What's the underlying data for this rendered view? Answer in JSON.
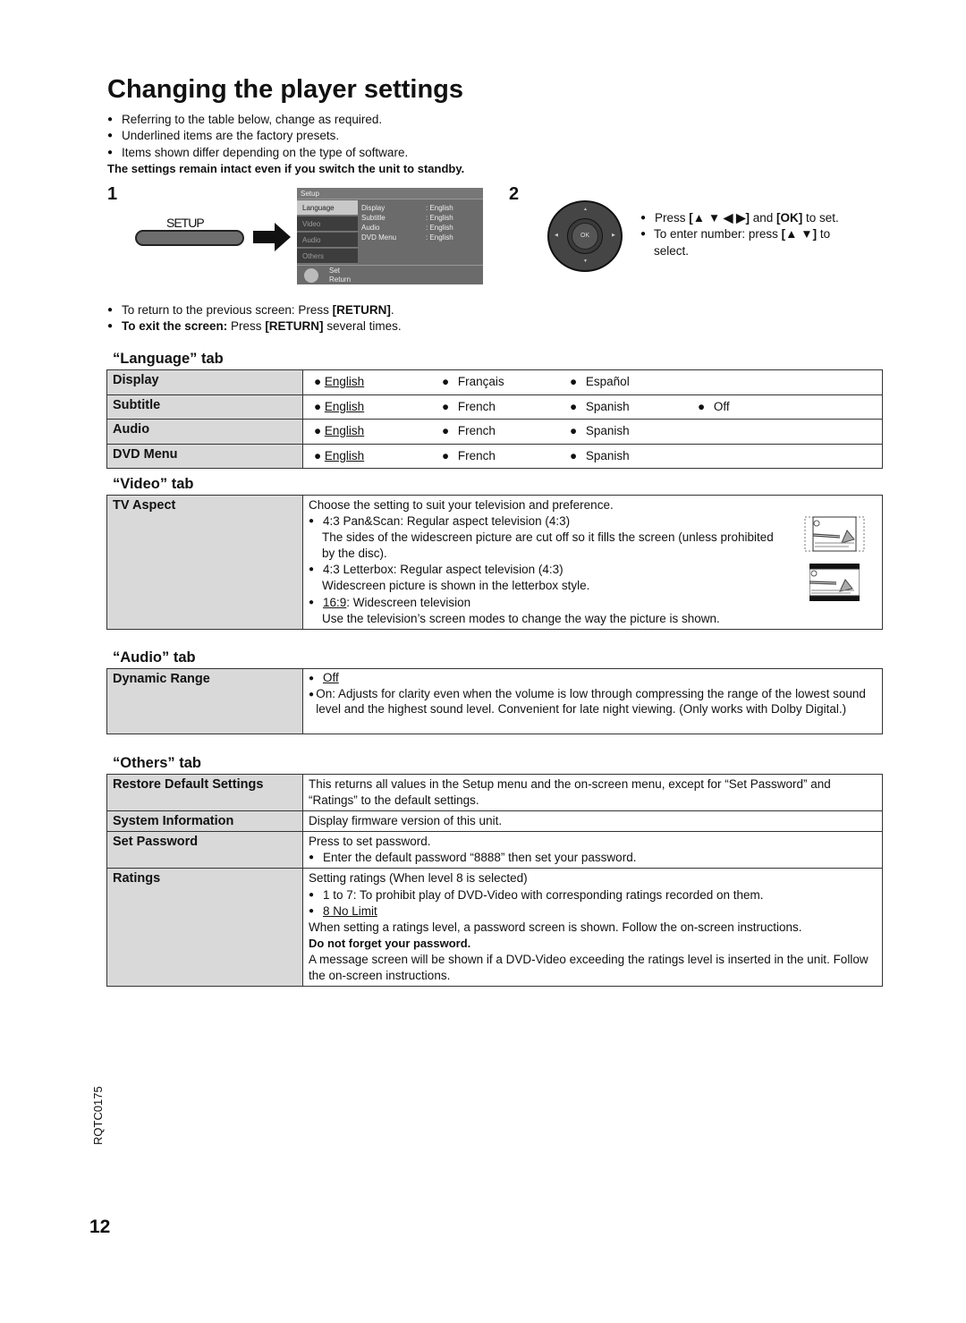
{
  "title": "Changing the player settings",
  "intro": {
    "bullets": [
      "Referring to the table below, change as required.",
      "Underlined items are the factory presets.",
      "Items shown differ depending on the type of software."
    ],
    "bold_note": "The settings remain intact even if you switch the unit to standby."
  },
  "step1": {
    "number": "1",
    "button_label": "SETUP",
    "osd": {
      "title": "Setup",
      "tabs": [
        "Language",
        "Video",
        "Audio",
        "Others"
      ],
      "active_tab": "Language",
      "rows": [
        {
          "key": "Display",
          "value": ": English"
        },
        {
          "key": "Subtitle",
          "value": ": English"
        },
        {
          "key": "Audio",
          "value": ": English"
        },
        {
          "key": "DVD Menu",
          "value": ": English"
        }
      ],
      "footer_set": "Set",
      "footer_return": "Return"
    }
  },
  "step2": {
    "number": "2",
    "ok_label": "OK",
    "bullet1_pre": "Press ",
    "bullet1_keys": "[▲ ▼ ◀ ▶]",
    "bullet1_mid": " and ",
    "bullet1_ok": "[OK]",
    "bullet1_post": " to set.",
    "bullet2_pre": "To enter number: press ",
    "bullet2_keys": "[▲ ▼]",
    "bullet2_post": " to select."
  },
  "notes": {
    "return_pre": "To return to the previous screen: Press ",
    "return_key": "[RETURN]",
    "return_post": ".",
    "exit_bold": "To exit the screen:",
    "exit_mid": " Press ",
    "exit_key": "[RETURN]",
    "exit_post": " several times."
  },
  "language_tab": {
    "title": "“Language” tab",
    "rows": [
      {
        "label": "Display",
        "options": [
          "English",
          "Français",
          "Español"
        ],
        "default": "English"
      },
      {
        "label": "Subtitle",
        "options": [
          "English",
          "French",
          "Spanish",
          "Off"
        ],
        "default": "English"
      },
      {
        "label": "Audio",
        "options": [
          "English",
          "French",
          "Spanish"
        ],
        "default": "English"
      },
      {
        "label": "DVD Menu",
        "options": [
          "English",
          "French",
          "Spanish"
        ],
        "default": "English"
      }
    ]
  },
  "video_tab": {
    "title": "“Video” tab",
    "label": "TV Aspect",
    "intro": "Choose the setting to suit your television and preference.",
    "opt1": "4:3 Pan&Scan: Regular aspect television (4:3)",
    "opt1_desc": "The sides of the widescreen picture are cut off so it fills the screen (unless prohibited by the disc).",
    "opt2": "4:3 Letterbox: Regular aspect television (4:3)",
    "opt2_desc": "Widescreen picture is shown in the letterbox style.",
    "opt3_default": "16:9",
    "opt3_rest": ": Widescreen television",
    "opt3_desc": "Use the television’s screen modes to change the way the picture is shown."
  },
  "audio_tab": {
    "title": "“Audio” tab",
    "label": "Dynamic Range",
    "opt_default": "Off",
    "opt_on": "On: Adjusts for clarity even when the volume is low through compressing the range of the lowest sound level and the highest sound level. Convenient for late night viewing. (Only works with Dolby Digital.)"
  },
  "others_tab": {
    "title": "“Others” tab",
    "restore_label": "Restore Default Settings",
    "restore_desc": "This returns all values in the Setup menu and the on-screen menu, except for “Set Password” and “Ratings” to the default settings.",
    "sysinfo_label": "System Information",
    "sysinfo_desc": "Display firmware version of this unit.",
    "password_label": "Set Password",
    "password_desc": "Press to set password.",
    "password_bullet": "Enter the default password “8888” then set your password.",
    "ratings_label": "Ratings",
    "ratings_intro": "Setting ratings (When level 8 is selected)",
    "ratings_opt1": "1 to 7: To prohibit play of DVD-Video with corresponding ratings recorded on them.",
    "ratings_opt2_default": "8 No Limit",
    "ratings_note": "When setting a ratings level, a password screen is shown. Follow the on-screen instructions.",
    "ratings_warning": "Do not forget your password.",
    "ratings_message": "A message screen will be shown if a DVD-Video exceeding the ratings level is inserted in the unit. Follow the on-screen instructions."
  },
  "footer": {
    "doc_code": "RQTC0175",
    "page_number": "12"
  }
}
